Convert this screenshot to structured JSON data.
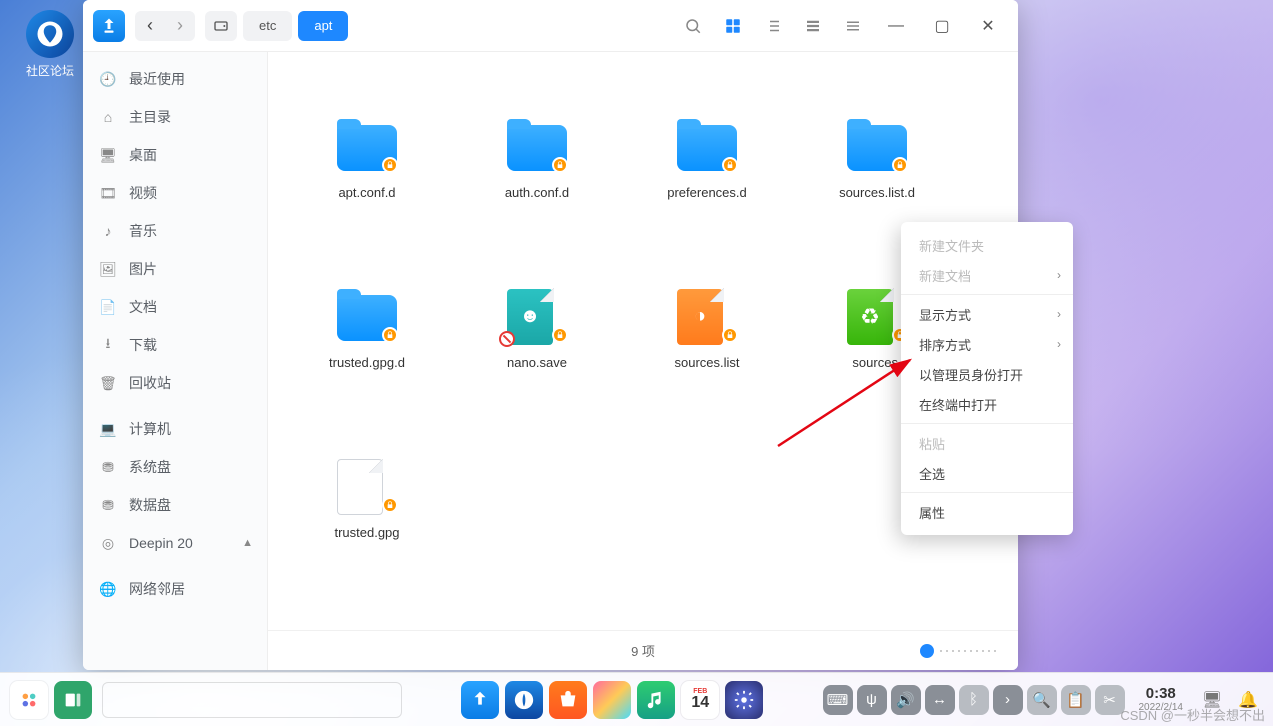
{
  "desktop": {
    "shortcut_label": "社区论坛"
  },
  "breadcrumbs": {
    "seg1": "etc",
    "seg2": "apt"
  },
  "sidebar": {
    "items": [
      {
        "label": "最近使用",
        "icon": "clock"
      },
      {
        "label": "主目录",
        "icon": "home"
      },
      {
        "label": "桌面",
        "icon": "desktop"
      },
      {
        "label": "视频",
        "icon": "video"
      },
      {
        "label": "音乐",
        "icon": "music"
      },
      {
        "label": "图片",
        "icon": "image"
      },
      {
        "label": "文档",
        "icon": "document"
      },
      {
        "label": "下载",
        "icon": "download"
      },
      {
        "label": "回收站",
        "icon": "trash"
      },
      {
        "label": "计算机",
        "icon": "computer"
      },
      {
        "label": "系统盘",
        "icon": "disk"
      },
      {
        "label": "数据盘",
        "icon": "disk"
      },
      {
        "label": "Deepin 20",
        "icon": "disc",
        "eject": true
      },
      {
        "label": "网络邻居",
        "icon": "network"
      }
    ]
  },
  "files": [
    {
      "name": "apt.conf.d",
      "type": "folder",
      "locked": true
    },
    {
      "name": "auth.conf.d",
      "type": "folder",
      "locked": true
    },
    {
      "name": "preferences.d",
      "type": "folder",
      "locked": true
    },
    {
      "name": "sources.list.d",
      "type": "folder",
      "locked": true
    },
    {
      "name": "trusted.gpg.d",
      "type": "folder",
      "locked": true
    },
    {
      "name": "nano.save",
      "type": "nano",
      "locked": true
    },
    {
      "name": "sources.list",
      "type": "src",
      "locked": true
    },
    {
      "name": "sources.list.bak",
      "type": "recycle",
      "locked": true,
      "truncated": "sources."
    },
    {
      "name": "trusted.gpg",
      "type": "file",
      "locked": true
    }
  ],
  "status": {
    "count_text": "9 项"
  },
  "context_menu": {
    "new_folder": "新建文件夹",
    "new_doc": "新建文档",
    "view_mode": "显示方式",
    "sort_mode": "排序方式",
    "open_admin": "以管理员身份打开",
    "open_terminal": "在终端中打开",
    "paste": "粘贴",
    "select_all": "全选",
    "properties": "属性"
  },
  "taskbar": {
    "calendar": {
      "month": "FEB",
      "day": "14"
    },
    "clock": {
      "time": "0:38",
      "date": "2022/2/14"
    }
  },
  "watermark": "CSDN @一秒半会想不出"
}
